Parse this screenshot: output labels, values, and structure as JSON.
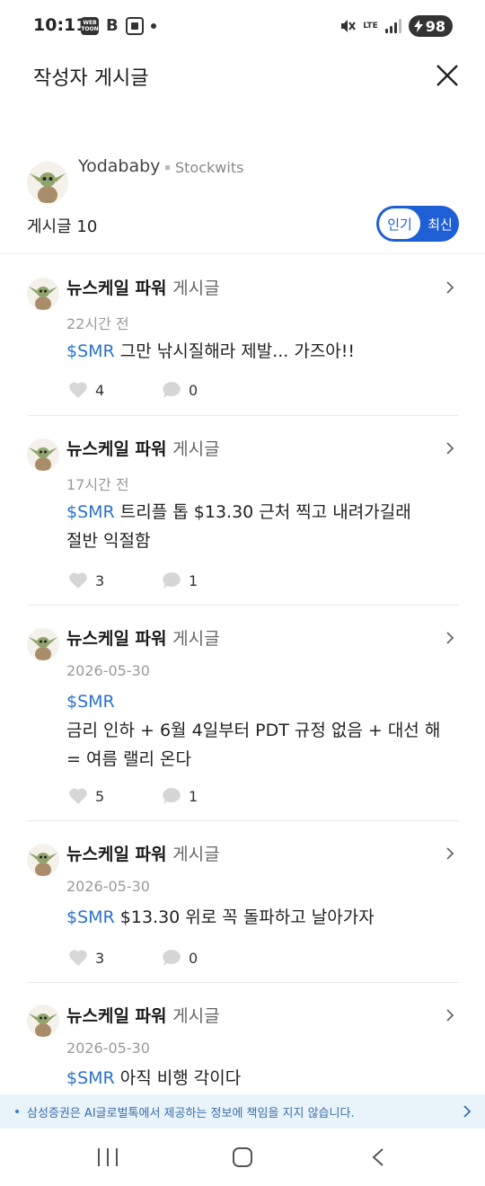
{
  "status_bar": {
    "time": "10:11",
    "webtoon_label": "WEB TOON",
    "b_label": "B",
    "lte_label": "LTE",
    "battery": "98",
    "icons": [
      "webtoon-icon",
      "b-icon",
      "screen-icon",
      "dot-icon",
      "mute-icon",
      "lte-icon",
      "signal-icon",
      "battery-charging-icon"
    ]
  },
  "header": {
    "title": "작성자 게시글",
    "close_icon": "close-icon"
  },
  "author": {
    "name": "Yodababy",
    "source": "Stockwits",
    "post_count_label": "게시글 10"
  },
  "sort_toggle": {
    "options": [
      "인기",
      "최신"
    ],
    "selected": "인기"
  },
  "posts": [
    {
      "author": "뉴스케일 파워",
      "author_suffix": "게시글",
      "time": "22시간 전",
      "ticker": "$SMR",
      "text_inline": " 그만 낚시질해라 제발... 가즈아!!",
      "text_lines": [],
      "likes": "4",
      "comments": "0"
    },
    {
      "author": "뉴스케일 파워",
      "author_suffix": "게시글",
      "time": "17시간 전",
      "ticker": "$SMR",
      "text_inline": " 트리플 톱 $13.30 근처 찍고 내려가길래",
      "text_lines": [
        "절반 익절함"
      ],
      "likes": "3",
      "comments": "1"
    },
    {
      "author": "뉴스케일 파워",
      "author_suffix": "게시글",
      "time": "2026-05-30",
      "ticker": "$SMR",
      "text_inline": "",
      "text_lines": [
        "금리 인하 + 6월 4일부터 PDT 규정 없음 + 대선 해",
        "= 여름 랠리 온다"
      ],
      "likes": "5",
      "comments": "1"
    },
    {
      "author": "뉴스케일 파워",
      "author_suffix": "게시글",
      "time": "2026-05-30",
      "ticker": "$SMR",
      "text_inline": " $13.30 위로 꼭 돌파하고 날아가자",
      "text_lines": [],
      "likes": "3",
      "comments": "0"
    },
    {
      "author": "뉴스케일 파워",
      "author_suffix": "게시글",
      "time": "2026-05-30",
      "ticker": "$SMR",
      "text_inline": " 아직 비행 각이다",
      "text_lines": [],
      "likes": "",
      "comments": ""
    }
  ],
  "disclaimer": {
    "text": "삼성증권은 AI글로벌톡에서 제공하는 정보에 책임을 지지 않습니다."
  },
  "nav": {
    "icons": [
      "recent-apps-icon",
      "home-icon",
      "back-icon"
    ]
  },
  "colors": {
    "accent": "#1f5fd6",
    "ticker": "#2b72c9",
    "disclaimer_bg": "#e9f3fa"
  }
}
